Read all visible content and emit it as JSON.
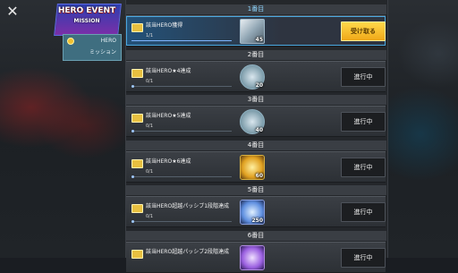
{
  "window": {
    "close_icon": "close-icon"
  },
  "banner": {
    "title": "HERO EVENT",
    "subtitle": "MISSION"
  },
  "side_tab": {
    "line1": "HERO",
    "line2": "ミッション"
  },
  "missions": [
    {
      "header": "1番目",
      "title": "該当HERO獲得",
      "progress": "1/1",
      "progress_fraction": 1.0,
      "reward_icon": "ticket-icon",
      "reward_count": "45",
      "button": "受け取る"
    },
    {
      "header": "2番目",
      "title": "該当HERO★4達成",
      "progress": "0/1",
      "progress_fraction": 0.0,
      "reward_icon": "badge-icon",
      "reward_count": "20",
      "button": "進行中"
    },
    {
      "header": "3番目",
      "title": "該当HERO★5達成",
      "progress": "0/1",
      "progress_fraction": 0.0,
      "reward_icon": "badge-icon",
      "reward_count": "40",
      "button": "進行中"
    },
    {
      "header": "4番目",
      "title": "該当HERO★6達成",
      "progress": "0/1",
      "progress_fraction": 0.0,
      "reward_icon": "gold-gem-icon",
      "reward_count": "60",
      "button": "進行中"
    },
    {
      "header": "5番目",
      "title": "該当HERO超越パッシブ1段階達成",
      "progress": "0/1",
      "progress_fraction": 0.0,
      "reward_icon": "blue-gem-icon",
      "reward_count": "250",
      "button": "進行中"
    },
    {
      "header": "6番目",
      "title": "該当HERO超越パッシブ2段階達成",
      "progress": "0/1",
      "progress_fraction": 0.0,
      "reward_icon": "purple-gem-icon",
      "reward_count": "",
      "button": "進行中"
    }
  ]
}
